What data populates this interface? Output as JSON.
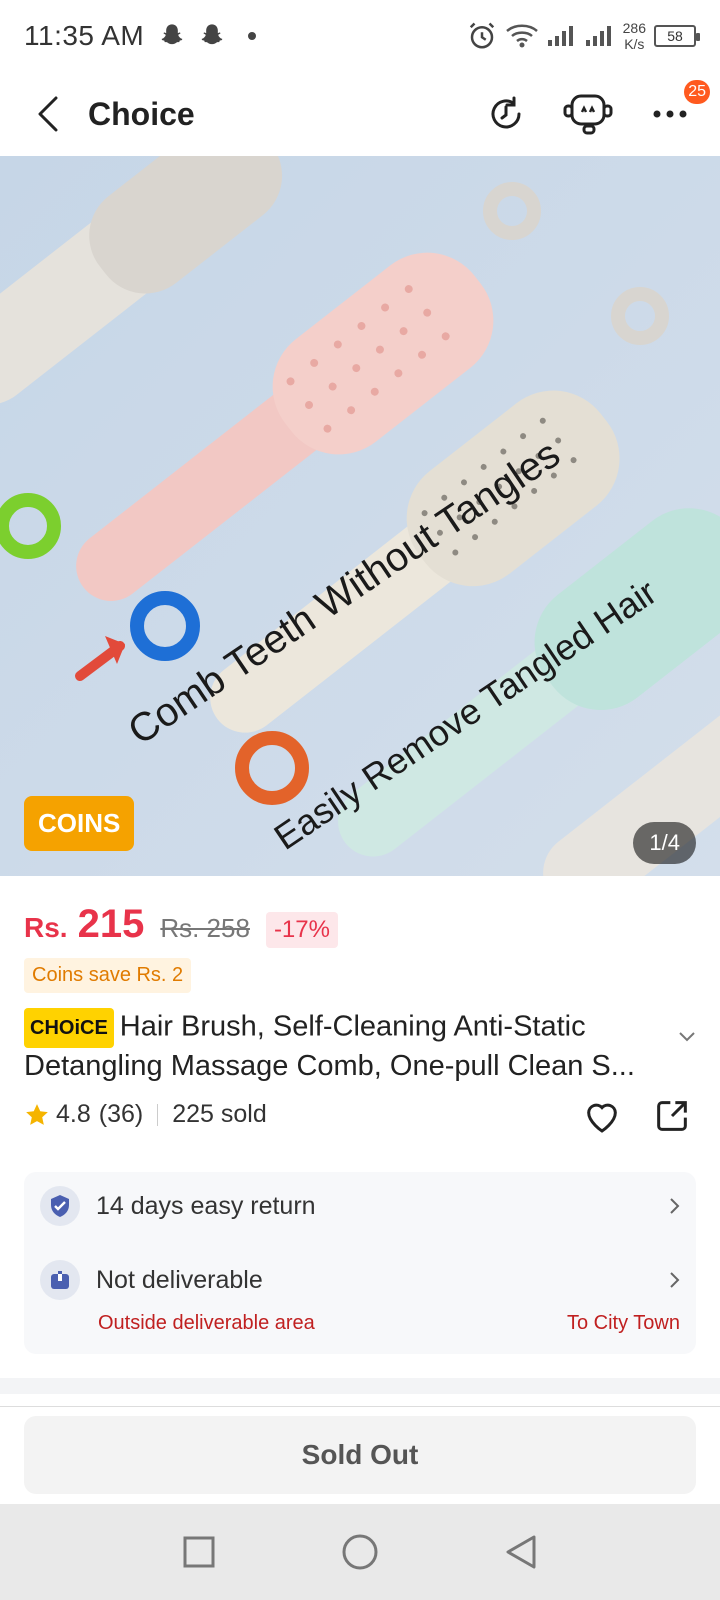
{
  "status_bar": {
    "time": "11:35 AM",
    "speed_value": "286",
    "speed_unit": "K/s",
    "battery": "58"
  },
  "header": {
    "title": "Choice",
    "cart_badge": "25"
  },
  "hero": {
    "coins_label": "COINS",
    "image_counter": "1/4",
    "image_text_1": "Comb Teeth Without Tangles",
    "image_text_2": "Easily Remove Tangled Hair"
  },
  "price": {
    "currency": "Rs.",
    "value": "215",
    "old_price": "Rs. 258",
    "discount": "-17%",
    "coins_save": "Coins save Rs. 2"
  },
  "product": {
    "choice_tag": "CHOiCE",
    "title": "Hair Brush, Self-Cleaning Anti-Static Detangling Massage Comb, One-pull Clean S...",
    "rating": "4.8",
    "reviews": "(36)",
    "sold": "225 sold"
  },
  "info": {
    "return_label": "14 days easy return",
    "delivery_label": "Not deliverable",
    "delivery_note": "Outside deliverable area",
    "delivery_location": "To City Town"
  },
  "footer": {
    "sold_out_label": "Sold Out"
  },
  "colors": {
    "accent_red": "#e8334a",
    "coins_orange": "#f5a200",
    "choice_yellow": "#ffd200"
  }
}
